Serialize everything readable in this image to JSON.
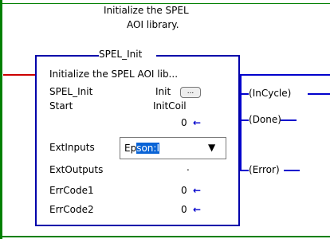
{
  "colors": {
    "rail": "#008000",
    "wire": "#0000cc",
    "input_wire": "#cc0000",
    "box": "#0000aa",
    "text": "#000000",
    "selection": "#0a64d6"
  },
  "comment": {
    "line1": "Initialize the SPEL",
    "line2": "AOI library."
  },
  "instruction": {
    "name": "SPEL_Init",
    "description": "Initialize the SPEL AOI lib...",
    "params": {
      "spel_init": {
        "label": "SPEL_Init",
        "value": "Init"
      },
      "start": {
        "label": "Start",
        "value": "InitCoil",
        "sub_value": "0"
      },
      "ext_inputs": {
        "label": "ExtInputs",
        "selected_text": "Ep",
        "highlighted_text": "son:I"
      },
      "ext_outputs": {
        "label": "ExtOutputs",
        "value": "."
      },
      "errcode1": {
        "label": "ErrCode1",
        "value": "0"
      },
      "errcode2": {
        "label": "ErrCode2",
        "value": "0"
      }
    }
  },
  "outputs": {
    "incycle": "InCycle",
    "done": "Done",
    "error": "Error"
  },
  "icons": {
    "arrow": "←",
    "ellipsis": "...",
    "dropdown": "▼"
  }
}
